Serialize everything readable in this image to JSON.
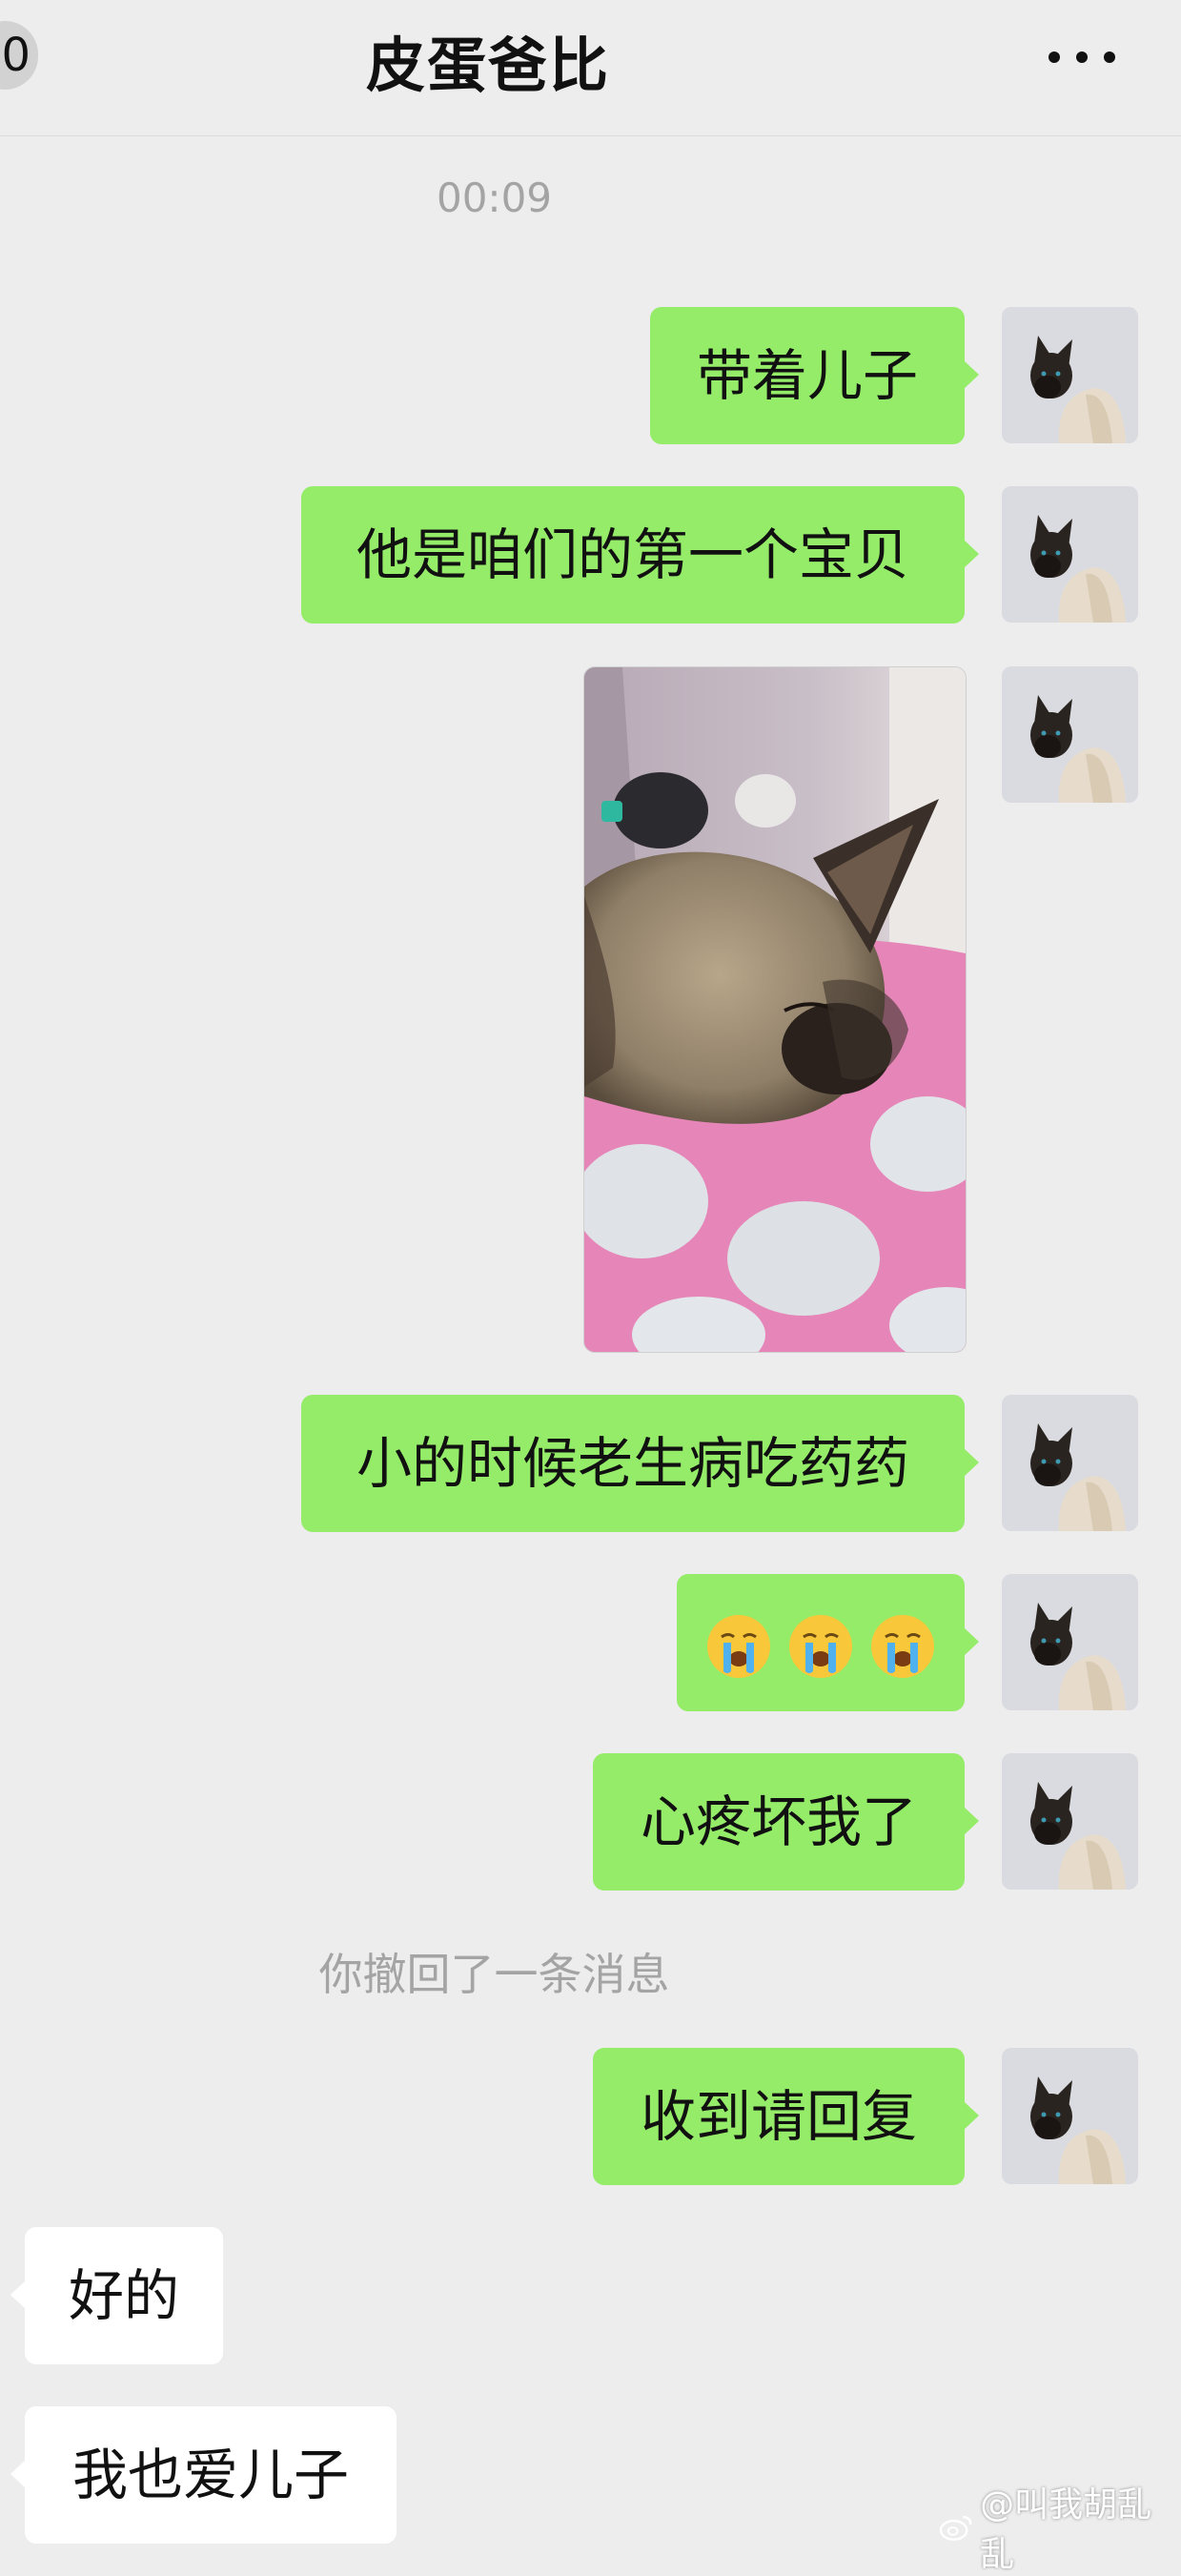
{
  "header": {
    "back_badge": "0",
    "title": "皮蛋爸比",
    "menu_icon": "more-dots-icon"
  },
  "chat": {
    "timestamp": "00:09",
    "messages": [
      {
        "side": "out",
        "type": "text",
        "text": "带着儿子"
      },
      {
        "side": "out",
        "type": "text",
        "text": "他是咱们的第一个宝贝"
      },
      {
        "side": "out",
        "type": "image",
        "description_icon": "sleeping-kitten-photo"
      },
      {
        "side": "out",
        "type": "text",
        "text": "小的时候老生病吃药药"
      },
      {
        "side": "out",
        "type": "emoji",
        "emojis": [
          "crying-face-emoji",
          "crying-face-emoji",
          "crying-face-emoji"
        ]
      },
      {
        "side": "out",
        "type": "text",
        "text": "心疼坏我了"
      },
      {
        "side": "out",
        "type": "text",
        "text": "收到请回复"
      },
      {
        "side": "in",
        "type": "text",
        "text": "好的"
      },
      {
        "side": "in",
        "type": "text",
        "text": "我也爱儿子"
      }
    ],
    "recall_notice": "你撤回了一条消息"
  },
  "watermark": {
    "text": "@叫我胡乱乱",
    "icon": "weibo-icon"
  },
  "colors": {
    "background": "#ededed",
    "outgoing_bubble": "#95ec69",
    "incoming_bubble": "#ffffff",
    "timestamp_text": "#a4a4a4"
  }
}
